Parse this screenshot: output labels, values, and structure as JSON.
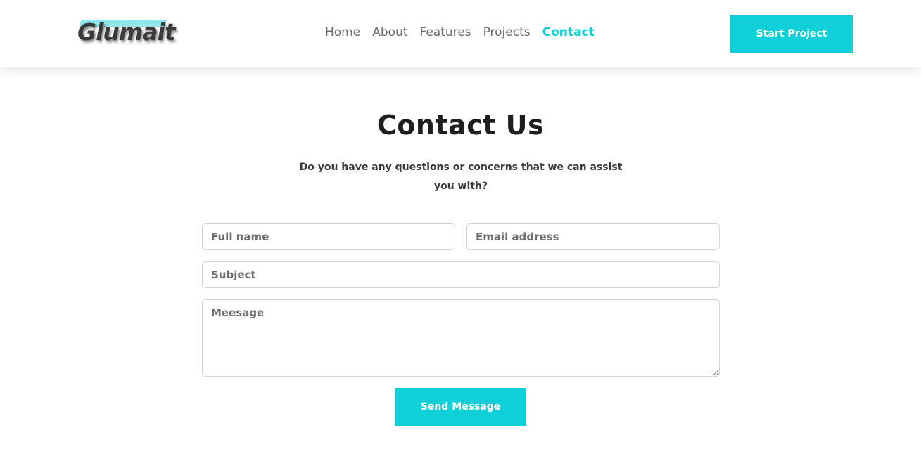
{
  "header": {
    "logo_text": "Glumait",
    "nav": [
      {
        "label": "Home",
        "active": false
      },
      {
        "label": "About",
        "active": false
      },
      {
        "label": "Features",
        "active": false
      },
      {
        "label": "Projects",
        "active": false
      },
      {
        "label": "Contact",
        "active": true
      }
    ],
    "cta_label": "Start Project"
  },
  "contact": {
    "title": "Contact Us",
    "subtitle": "Do you have any questions or concerns that we can assist you with?",
    "fields": {
      "full_name": {
        "placeholder": "Full name",
        "value": ""
      },
      "email": {
        "placeholder": "Email address",
        "value": ""
      },
      "subject": {
        "placeholder": "Subject",
        "value": ""
      },
      "message": {
        "placeholder": "Meesage",
        "value": ""
      }
    },
    "submit_label": "Send Message"
  },
  "colors": {
    "accent": "#0fcfd8",
    "nav_text": "#6b6b6b",
    "heading": "#1e1e1e"
  }
}
